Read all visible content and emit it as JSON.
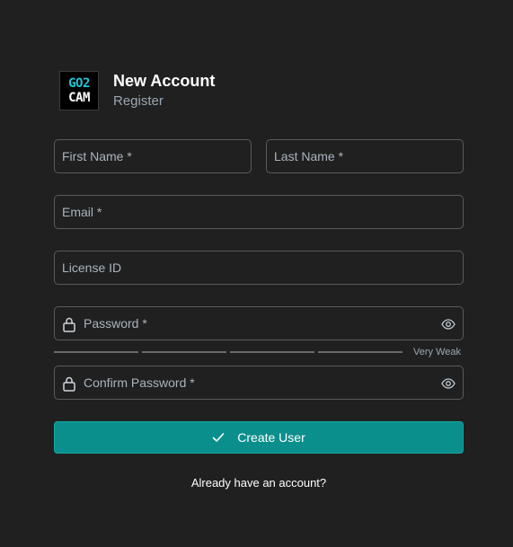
{
  "brand": {
    "logo_top": "GO2",
    "logo_bottom": "CAM",
    "title": "New Account",
    "subtitle": "Register"
  },
  "form": {
    "first_name": {
      "placeholder": "First Name *",
      "value": ""
    },
    "last_name": {
      "placeholder": "Last Name *",
      "value": ""
    },
    "email": {
      "placeholder": "Email *",
      "value": ""
    },
    "license_id": {
      "placeholder": "License ID",
      "value": ""
    },
    "password": {
      "placeholder": "Password *",
      "value": ""
    },
    "confirm_password": {
      "placeholder": "Confirm Password *",
      "value": ""
    },
    "strength_label": "Very Weak",
    "create_button_label": "Create User",
    "login_link": "Already have an account?"
  },
  "icons": {
    "lock": "lock-icon",
    "eye": "eye-icon",
    "check": "check-icon"
  },
  "colors": {
    "background": "#202020",
    "accent": "#0b8f8c",
    "logo_accent": "#1ec7d8",
    "border": "#5a5a5a"
  }
}
